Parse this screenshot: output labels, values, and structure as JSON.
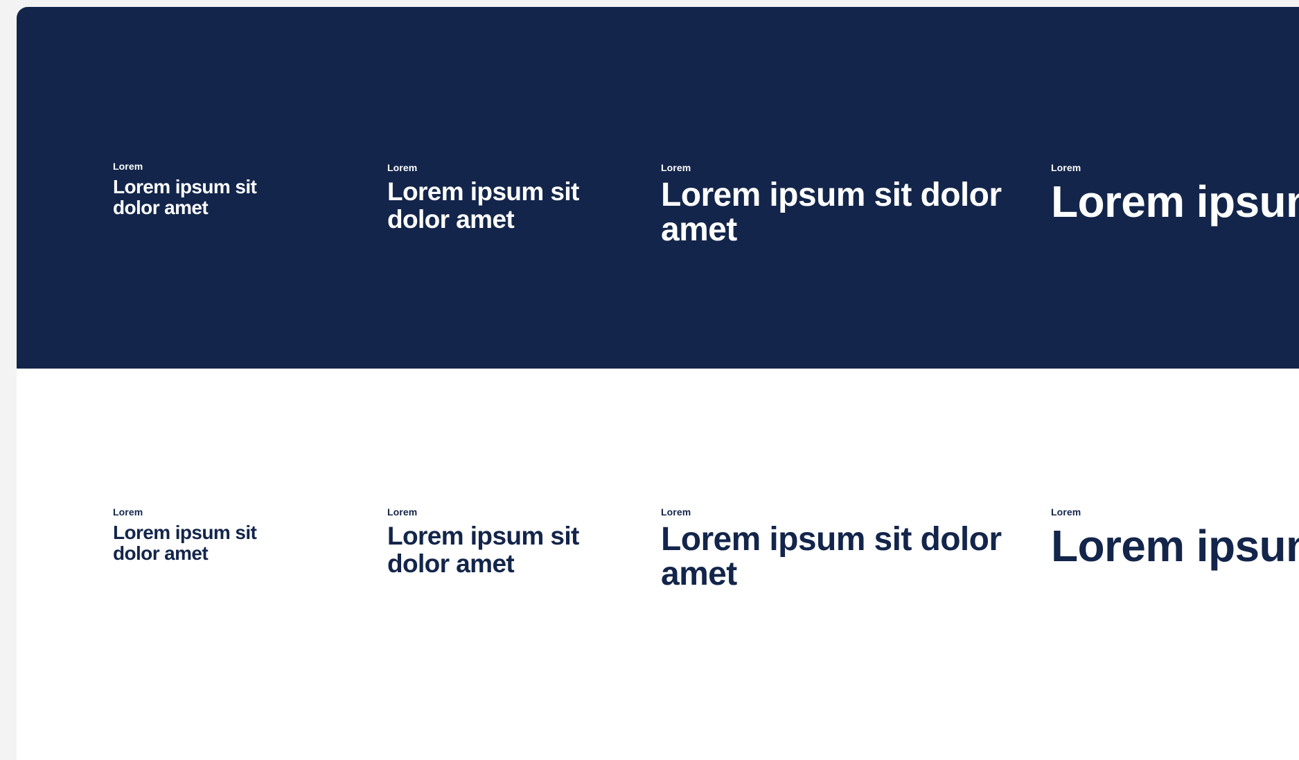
{
  "colors": {
    "navy": "#13254a",
    "white": "#ffffff",
    "background": "#f3f3f3"
  },
  "dark_panel": {
    "specimens": [
      {
        "eyebrow": "Lorem",
        "heading": "Lorem ipsum sit dolor amet"
      },
      {
        "eyebrow": "Lorem",
        "heading": "Lorem ipsum sit dolor amet"
      },
      {
        "eyebrow": "Lorem",
        "heading": "Lorem ipsum sit dolor amet"
      },
      {
        "eyebrow": "Lorem",
        "heading": "Lorem ipsum"
      }
    ]
  },
  "light_panel": {
    "specimens": [
      {
        "eyebrow": "Lorem",
        "heading": "Lorem ipsum sit dolor amet"
      },
      {
        "eyebrow": "Lorem",
        "heading": "Lorem ipsum sit dolor amet"
      },
      {
        "eyebrow": "Lorem",
        "heading": "Lorem ipsum sit dolor amet"
      },
      {
        "eyebrow": "Lorem",
        "heading": "Lorem ipsum"
      }
    ]
  }
}
